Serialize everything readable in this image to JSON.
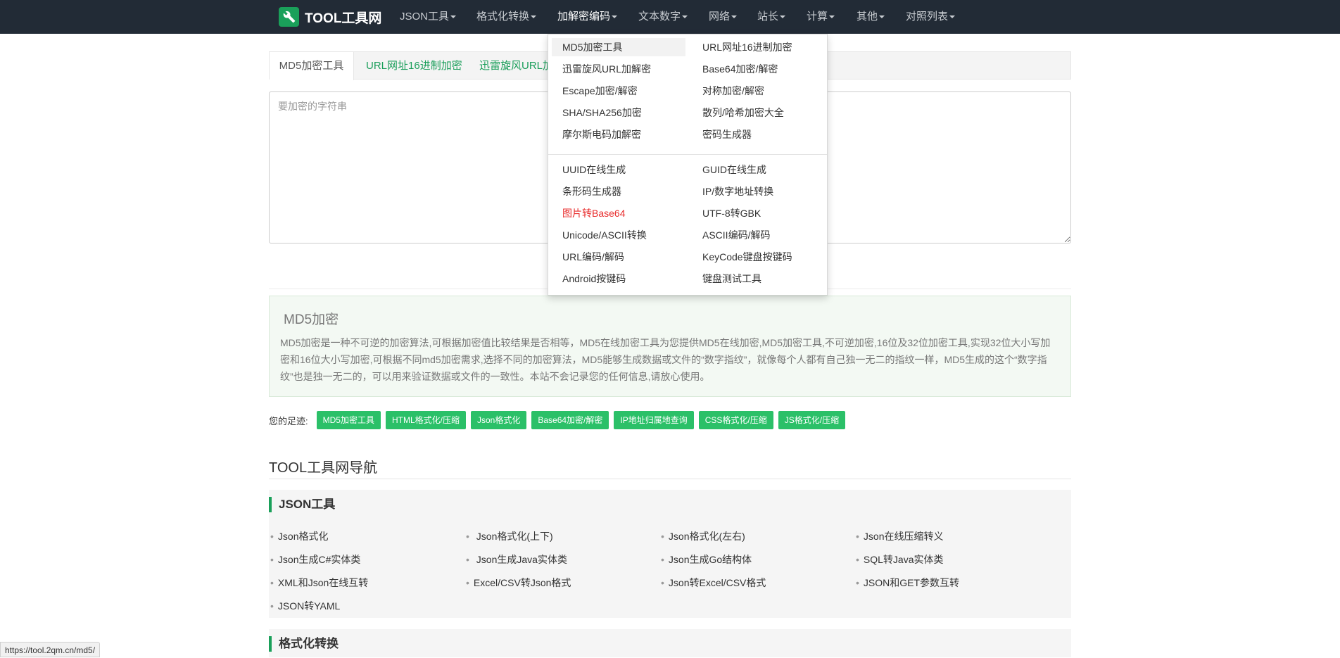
{
  "brand": {
    "name": "TOOL工具网",
    "icon": "wrench-icon"
  },
  "nav": [
    {
      "label": "JSON工具"
    },
    {
      "label": "格式化转换"
    },
    {
      "label": "加解密编码"
    },
    {
      "label": "文本数字"
    },
    {
      "label": "网络"
    },
    {
      "label": "站长"
    },
    {
      "label": "计算"
    },
    {
      "label": "其他"
    },
    {
      "label": "对照列表"
    }
  ],
  "tabs": [
    "MD5加密工具",
    "URL网址16进制加密",
    "迅雷旋风URL加"
  ],
  "input": {
    "placeholder": "要加密的字符串"
  },
  "dropdown": {
    "group1": [
      [
        "MD5加密工具",
        "URL网址16进制加密"
      ],
      [
        "迅雷旋风URL加解密",
        "Base64加密/解密"
      ],
      [
        "Escape加密/解密",
        "对称加密/解密"
      ],
      [
        "SHA/SHA256加密",
        "散列/哈希加密大全"
      ],
      [
        "摩尔斯电码加解密",
        "密码生成器"
      ]
    ],
    "group2": [
      [
        "UUID在线生成",
        "GUID在线生成"
      ],
      [
        "条形码生成器",
        "IP/数字地址转换"
      ],
      [
        "图片转Base64",
        "UTF-8转GBK"
      ],
      [
        "Unicode/ASCII转换",
        "ASCII编码/解码"
      ],
      [
        "URL编码/解码",
        "KeyCode键盘按键码"
      ],
      [
        "Android按键码",
        "键盘测试工具"
      ]
    ]
  },
  "info": {
    "title": "MD5加密",
    "text": "MD5加密是一种不可逆的加密算法,可根据加密值比较结果是否相等，MD5在线加密工具为您提供MD5在线加密,MD5加密工具,不可逆加密,16位及32位加密工具,实现32位大小写加密和16位大小写加密,可根据不同md5加密需求,选择不同的加密算法，MD5能够生成数据或文件的“数字指纹”，就像每个人都有自己独一无二的指纹一样，MD5生成的这个“数字指纹”也是独一无二的，可以用来验证数据或文件的一致性。本站不会记录您的任何信息,请放心使用。"
  },
  "footprint": {
    "label": "您的足迹:",
    "tags": [
      "MD5加密工具",
      "HTML格式化/压缩",
      "Json格式化",
      "Base64加密/解密",
      "IP地址归属地查询",
      "CSS格式化/压缩",
      "JS格式化/压缩"
    ]
  },
  "nav_section": {
    "title": "TOOL工具网导航",
    "json_cat": {
      "title": "JSON工具",
      "links": [
        "Json格式化",
        " Json格式化(上下)",
        "Json格式化(左右)",
        "Json在线压缩转义",
        "Json生成C#实体类",
        " Json生成Java实体类",
        "Json生成Go结构体",
        "SQL转Java实体类",
        "XML和Json在线互转",
        "Excel/CSV转Json格式",
        "Json转Excel/CSV格式",
        "JSON和GET参数互转",
        "JSON转YAML"
      ]
    },
    "format_cat": {
      "title": "格式化转换"
    }
  },
  "status_url": "https://tool.2qm.cn/md5/",
  "colors": {
    "navbar": "#222b36",
    "accent": "#1aa05a",
    "tag": "#2bc068",
    "red": "#e82b2b"
  }
}
